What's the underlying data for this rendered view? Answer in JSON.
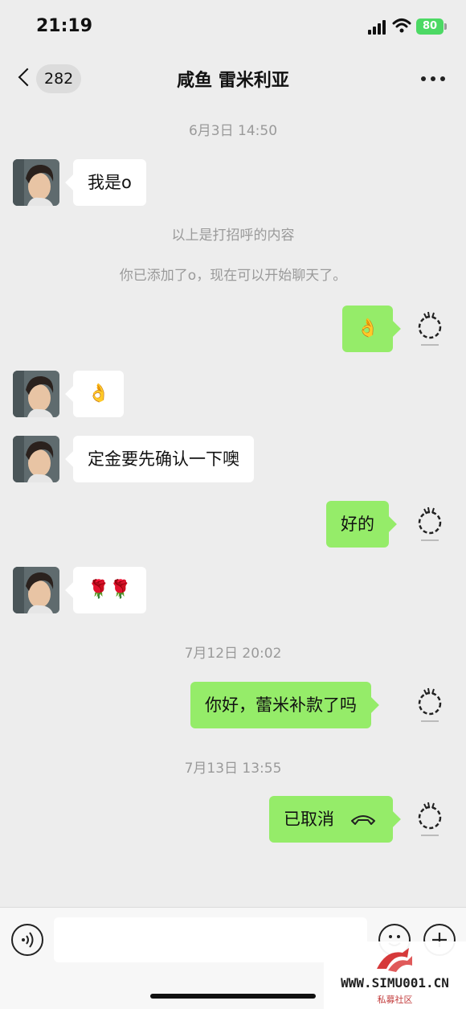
{
  "status_bar": {
    "time": "21:19",
    "battery": "80"
  },
  "nav": {
    "back_count": "282",
    "title": "咸鱼 雷米利亚"
  },
  "chat": {
    "time_1": "6月3日 14:50",
    "msg_1": "我是o",
    "system_1": "以上是打招呼的内容",
    "system_2": "你已添加了o，现在可以开始聊天了。",
    "msg_2": "👌",
    "msg_3": "👌",
    "msg_4": "定金要先确认一下噢",
    "msg_5": "好的",
    "msg_6": "🌹🌹",
    "time_2": "7月12日 20:02",
    "msg_7": "你好，蕾米补款了吗",
    "time_3": "7月13日 13:55",
    "msg_8": "已取消"
  },
  "input_bar": {
    "placeholder": ""
  },
  "watermark": {
    "url": "WWW.SIMU001.CN",
    "sub": "私募社区"
  }
}
